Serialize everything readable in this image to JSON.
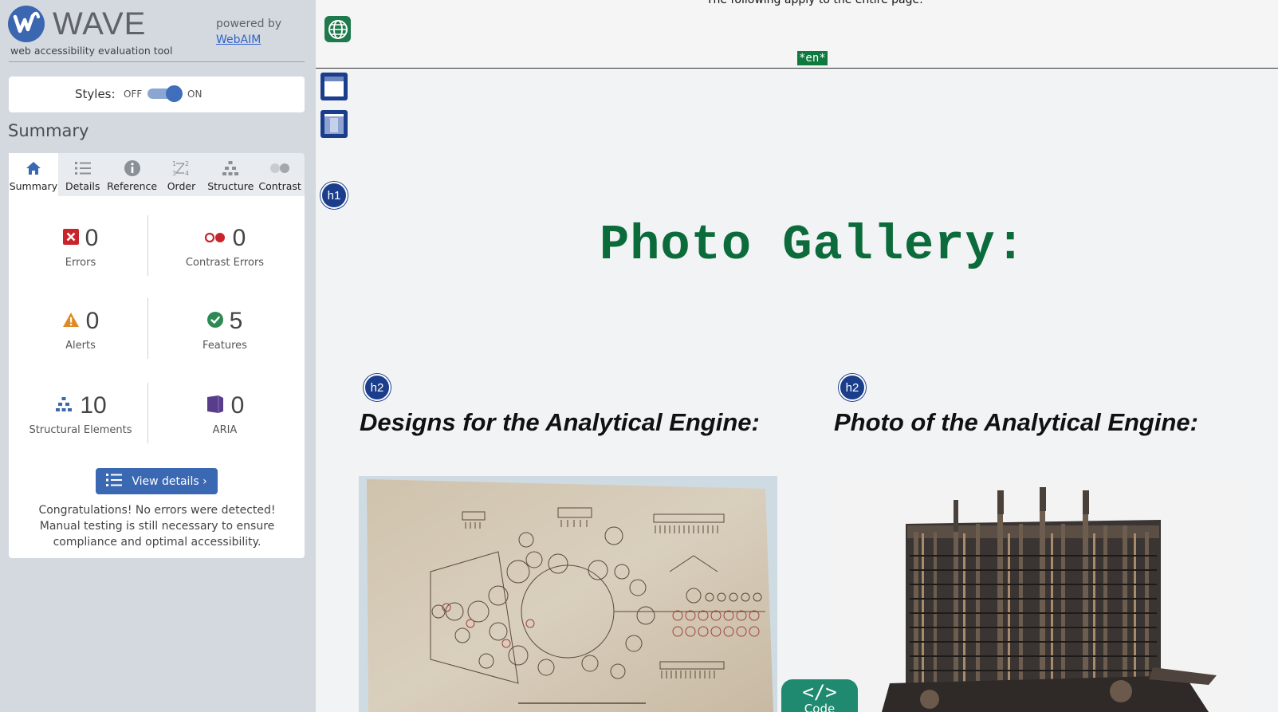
{
  "brand": {
    "logo_letter": "W",
    "name": "WAVE",
    "tagline": "web accessibility evaluation tool",
    "powered_by": "powered by",
    "powered_link": "WebAIM"
  },
  "styles_toggle": {
    "label": "Styles:",
    "off": "OFF",
    "on": "ON",
    "state": "on"
  },
  "summary": {
    "title": "Summary",
    "tabs": [
      {
        "label": "Summary",
        "icon": "home-icon",
        "active": true
      },
      {
        "label": "Details",
        "icon": "list-icon",
        "active": false
      },
      {
        "label": "Reference",
        "icon": "info-icon",
        "active": false
      },
      {
        "label": "Order",
        "icon": "order-icon",
        "active": false
      },
      {
        "label": "Structure",
        "icon": "structure-icon",
        "active": false
      },
      {
        "label": "Contrast",
        "icon": "contrast-icon",
        "active": false
      }
    ],
    "stats": {
      "errors": {
        "value": "0",
        "label": "Errors"
      },
      "contrast_errors": {
        "value": "0",
        "label": "Contrast Errors"
      },
      "alerts": {
        "value": "0",
        "label": "Alerts"
      },
      "features": {
        "value": "5",
        "label": "Features"
      },
      "structural": {
        "value": "10",
        "label": "Structural Elements"
      },
      "aria": {
        "value": "0",
        "label": "ARIA"
      }
    },
    "view_details": "View details ›",
    "message": "Congratulations! No errors were detected! Manual testing is still necessary to ensure compliance and optimal accessibility."
  },
  "page": {
    "top_text": "The following apply to the entire page:",
    "lang_tag": "*en*",
    "h1_badge": "h1",
    "h1": "Photo Gallery:",
    "h2_badge": "h2",
    "h2_left": "Designs for the Analytical Engine:",
    "h2_right": "Photo of the Analytical Engine:",
    "code_button": {
      "symbol": "</>",
      "label": "Code"
    }
  },
  "colors": {
    "sidebar_bg": "#d4d9e0",
    "accent_blue": "#3b68b2",
    "heading_green": "#0b6b3a",
    "badge_navy": "#1b3e8c",
    "code_teal": "#1f8a6f"
  }
}
